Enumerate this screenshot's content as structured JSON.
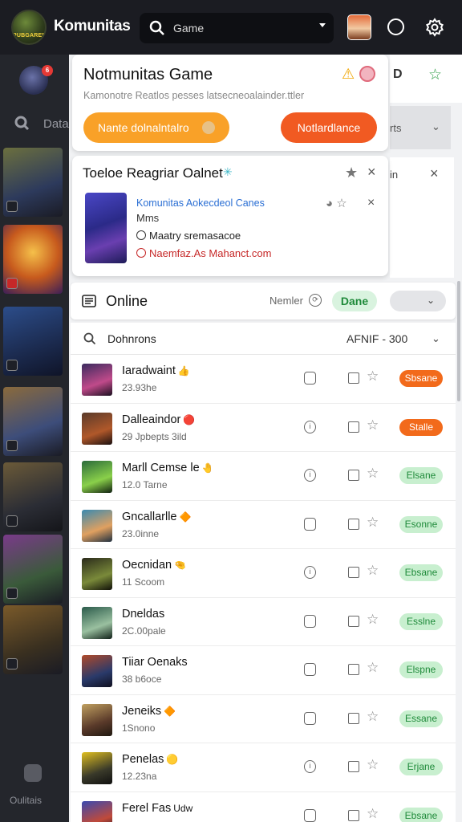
{
  "header": {
    "app_title": "Komunitas",
    "logo_text": "PUBGARENA",
    "search_value": "Game",
    "icons": [
      "search-icon",
      "avatar",
      "circle-icon",
      "gear-icon"
    ]
  },
  "rail": {
    "badge": "6",
    "search_label": "Data",
    "bottom_label": "Oulitais"
  },
  "right_column": {
    "d_label": "D",
    "mid_text": "rts",
    "mid_text2": "in"
  },
  "card1": {
    "title": "Notmunitas Game",
    "subtitle": "Kamonotre Reatlos pesses latsecneoalainder.ttler",
    "btn_left": "Nante dolnalntalro",
    "btn_right": "Notlardlance"
  },
  "card2": {
    "title": "Toeloe Reagriar Oalnet",
    "game_name": "Komunitas Aokecdeol Canes",
    "meta": "Mms",
    "option1": "Maatry sremasacoe",
    "option2": "Naemfaz.As Mahanct.com"
  },
  "online": {
    "label": "Online",
    "member_label": "Nemler",
    "done_label": "Dane"
  },
  "list": {
    "search_label": "Dohnrons",
    "range_label": "AFNIF  -  300",
    "rows": [
      {
        "name": "Iaradwaint",
        "emoji": "👍",
        "sub": "23.93he",
        "status": "Sbsane",
        "status_color": "orange",
        "c1": "box"
      },
      {
        "name": "Dalleaindor",
        "emoji": "🔴",
        "sub": "29 Jpbepts 3ild",
        "status": "Stalle",
        "status_color": "orange",
        "c1": "info"
      },
      {
        "name": "Marll Cemse le",
        "emoji": "🤚",
        "sub": "12.0 Tarne",
        "status": "Elsane",
        "status_color": "green",
        "c1": "info"
      },
      {
        "name": "Gncallarlle",
        "emoji": "🔶",
        "sub": "23.0inne",
        "status": "Esonne",
        "status_color": "green",
        "c1": "box"
      },
      {
        "name": "Oecnidan",
        "emoji": "🤏",
        "sub": "11 Scoom",
        "status": "Ebsane",
        "status_color": "green",
        "c1": "info"
      },
      {
        "name": "Dneldas",
        "emoji": "",
        "sub": "2C.00pale",
        "status": "Esslne",
        "status_color": "green",
        "c1": "box"
      },
      {
        "name": "Tiiar Oenaks",
        "emoji": "",
        "sub": "38 b6oce",
        "status": "Elspne",
        "status_color": "green",
        "c1": "box"
      },
      {
        "name": "Jeneiks",
        "emoji": "🔶",
        "sub": "1Snono",
        "status": "Essane",
        "status_color": "green",
        "c1": "box"
      },
      {
        "name": "Penelas",
        "emoji": "🟡",
        "sub": "12.23na",
        "status": "Erjane",
        "status_color": "green",
        "c1": "info"
      },
      {
        "name": "Ferel Fas",
        "emoji": "Udw",
        "sub": "",
        "status": "Ebsane",
        "status_color": "green",
        "c1": "box"
      }
    ]
  }
}
